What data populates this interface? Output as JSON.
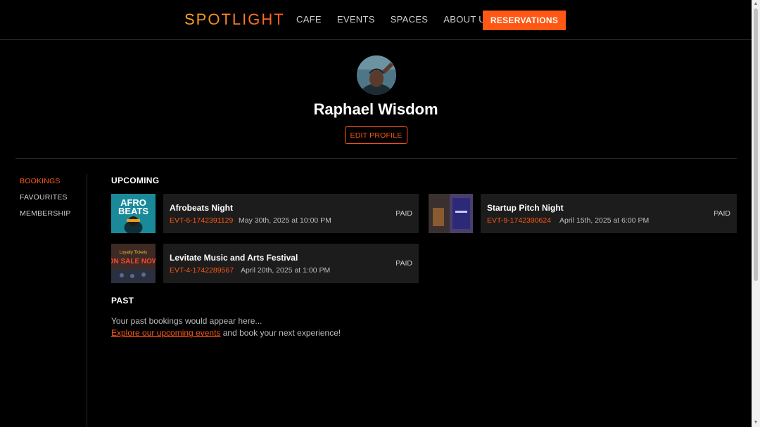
{
  "header": {
    "logo": "SPOTLIGHT",
    "nav": [
      "CAFE",
      "EVENTS",
      "SPACES",
      "ABOUT US"
    ],
    "cta": "RESERVATIONS"
  },
  "profile": {
    "name": "Raphael Wisdom",
    "edit_label": "EDIT PROFILE"
  },
  "sidebar": {
    "items": [
      {
        "label": "BOOKINGS",
        "active": true
      },
      {
        "label": "FAVOURITES",
        "active": false
      },
      {
        "label": "MEMBERSHIP",
        "active": false
      }
    ]
  },
  "upcoming": {
    "title": "UPCOMING",
    "bookings": [
      {
        "title": "Afrobeats Night",
        "id": "EVT-6-1742391129",
        "date": "May 30th, 2025 at 10:00 PM",
        "status": "PAID",
        "thumb_text": "AFRO BEATS"
      },
      {
        "title": "Startup Pitch Night",
        "id": "EVT-9-1742390624",
        "date": "April 15th, 2025 at 6:00 PM",
        "status": "PAID",
        "thumb_text": ""
      },
      {
        "title": "Levitate Music and Arts Festival",
        "id": "EVT-4-1742289567",
        "date": "April 20th, 2025 at 1:00 PM",
        "status": "PAID",
        "thumb_text": "ON SALE NOW"
      }
    ]
  },
  "past": {
    "title": "PAST",
    "empty_text": "Your past bookings would appear here...",
    "link_text": "Explore our upcoming events",
    "suffix_text": " and book your next experience!"
  },
  "colors": {
    "accent": "#ff5714",
    "background": "#000000",
    "card": "#1c1c1c"
  }
}
